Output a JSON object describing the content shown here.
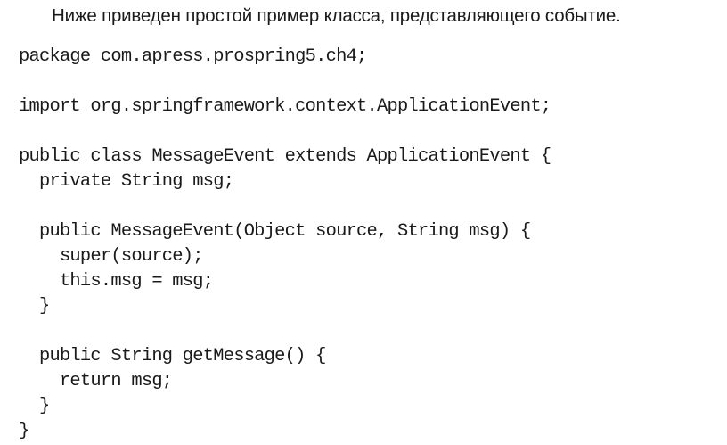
{
  "intro_text": "Ниже приведен простой пример класса, представляющего событие.",
  "code_lines": [
    "package com.apress.prospring5.ch4;",
    "",
    "import org.springframework.context.ApplicationEvent;",
    "",
    "public class MessageEvent extends ApplicationEvent {",
    "  private String msg;",
    "",
    "  public MessageEvent(Object source, String msg) {",
    "    super(source);",
    "    this.msg = msg;",
    "  }",
    "",
    "  public String getMessage() {",
    "    return msg;",
    "  }",
    "}"
  ]
}
